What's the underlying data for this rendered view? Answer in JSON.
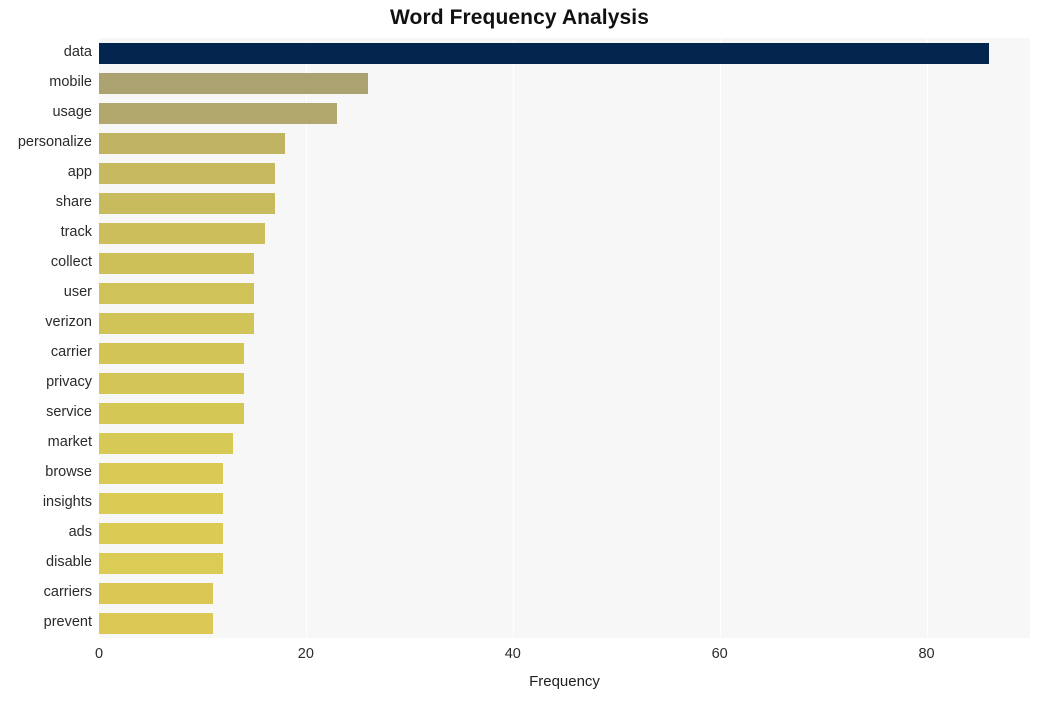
{
  "chart_data": {
    "type": "bar",
    "orientation": "horizontal",
    "title": "Word Frequency Analysis",
    "xlabel": "Frequency",
    "ylabel": "",
    "xlim": [
      0,
      90
    ],
    "ylim": null,
    "grid": true,
    "legend": false,
    "legend_position": "none",
    "xticks": [
      0,
      20,
      40,
      60,
      80
    ],
    "xtick_labels": [
      "0",
      "20",
      "40",
      "60",
      "80"
    ],
    "categories": [
      "data",
      "mobile",
      "usage",
      "personalize",
      "app",
      "share",
      "track",
      "collect",
      "user",
      "verizon",
      "carrier",
      "privacy",
      "service",
      "market",
      "browse",
      "insights",
      "ads",
      "disable",
      "carriers",
      "prevent"
    ],
    "values": [
      86,
      26,
      23,
      18,
      17,
      17,
      16,
      15,
      15,
      15,
      14,
      14,
      14,
      13,
      12,
      12,
      12,
      12,
      11,
      11
    ],
    "bar_colors": [
      "#04254d",
      "#aca271",
      "#b2a76d",
      "#c0b463",
      "#c6b95f",
      "#c8bb5d",
      "#cbbe5b",
      "#cdc059",
      "#cfc258",
      "#d0c357",
      "#d2c556",
      "#d3c656",
      "#d4c755",
      "#d6c955",
      "#d8ca54",
      "#d9cb54",
      "#d9cb54",
      "#dacc54",
      "#dbc854",
      "#dcc854"
    ]
  },
  "figure": {
    "plot_background": "#f7f7f7",
    "page_background": "#ffffff",
    "gridline_color": "#ffffff",
    "title_color": "#111111",
    "tick_color": "#2b2b2b"
  }
}
